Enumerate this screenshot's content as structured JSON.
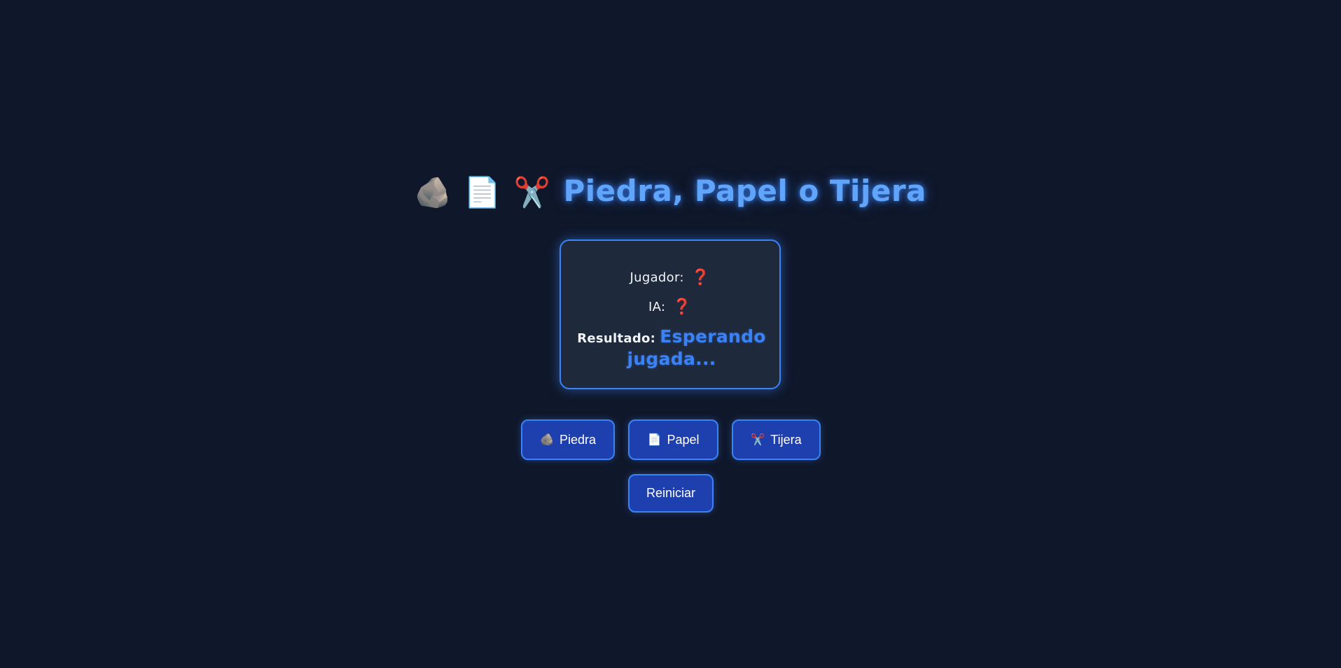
{
  "title": {
    "icons": [
      "rock-emoji",
      "paper-emoji",
      "scissors-emoji"
    ],
    "text": "Piedra, Papel o Tijera"
  },
  "scoreboard": {
    "player_label": "Jugador:",
    "player_value": "❓",
    "ai_label": "IA:",
    "ai_value": "❓",
    "result_label": "Resultado:",
    "result_value": "Esperando jugada..."
  },
  "buttons": {
    "rock_label": "Piedra",
    "paper_label": "Papel",
    "scissors_label": "Tijera",
    "reset_label": "Reiniciar"
  },
  "colors": {
    "background": "#0f172a",
    "card": "#1e293b",
    "accent": "#3b82f6",
    "button": "#1e40af",
    "question_mark": "#f43f5e"
  }
}
